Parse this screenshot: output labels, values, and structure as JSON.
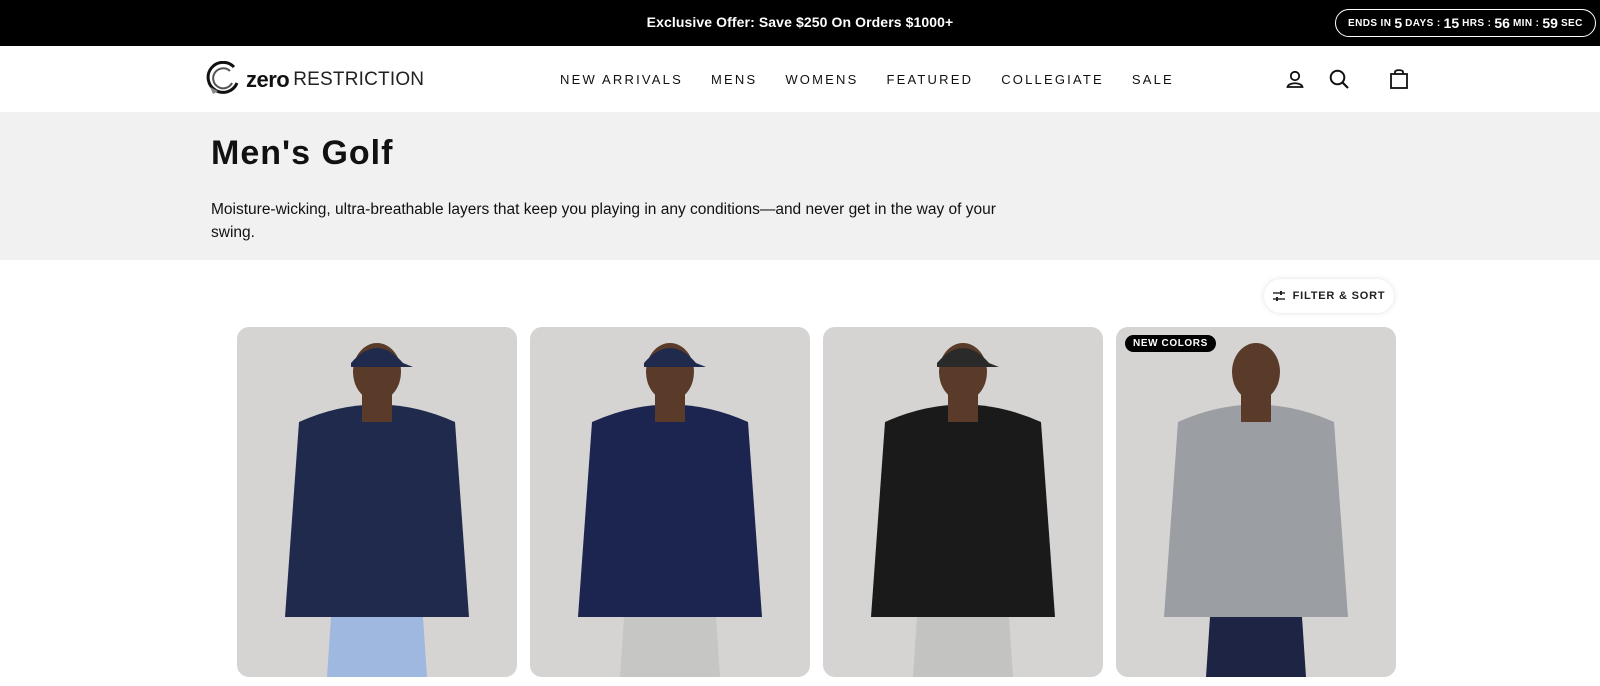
{
  "announcement": {
    "offer": "Exclusive Offer: Save $250 On Orders $1000+",
    "countdown": {
      "prefix": "ENDS IN",
      "days": "5",
      "days_label": "DAYS :",
      "hours": "15",
      "hours_label": "HRS :",
      "minutes": "56",
      "minutes_label": "MIN :",
      "seconds": "59",
      "seconds_label": "SEC"
    }
  },
  "header": {
    "logo_bold": "zero",
    "logo_light": "RESTRICTION",
    "nav": [
      "NEW ARRIVALS",
      "MENS",
      "WOMENS",
      "FEATURED",
      "COLLEGIATE",
      "SALE"
    ],
    "icons": [
      "account-icon",
      "search-icon",
      "cart-icon"
    ]
  },
  "hero": {
    "title": "Men's Golf",
    "description": "Moisture-wicking, ultra-breathable layers that keep you playing in any conditions—and never get in the way of your swing."
  },
  "filter": {
    "label": "FILTER & SORT",
    "icon": "sliders-icon"
  },
  "products": [
    {
      "badge": "",
      "jacket": "#1f2a4d",
      "cap": "#1f2a4d",
      "pants": "#9fb8e0"
    },
    {
      "badge": "",
      "jacket": "#1c2550",
      "cap": "#1f2a4d",
      "pants": "#c6c6c4"
    },
    {
      "badge": "",
      "jacket": "#1a1a1a",
      "cap": "#2a2a2a",
      "pants": "#c3c3c1"
    },
    {
      "badge": "NEW COLORS",
      "jacket": "#9b9ea3",
      "cap": "",
      "pants": "#1d2444"
    }
  ]
}
